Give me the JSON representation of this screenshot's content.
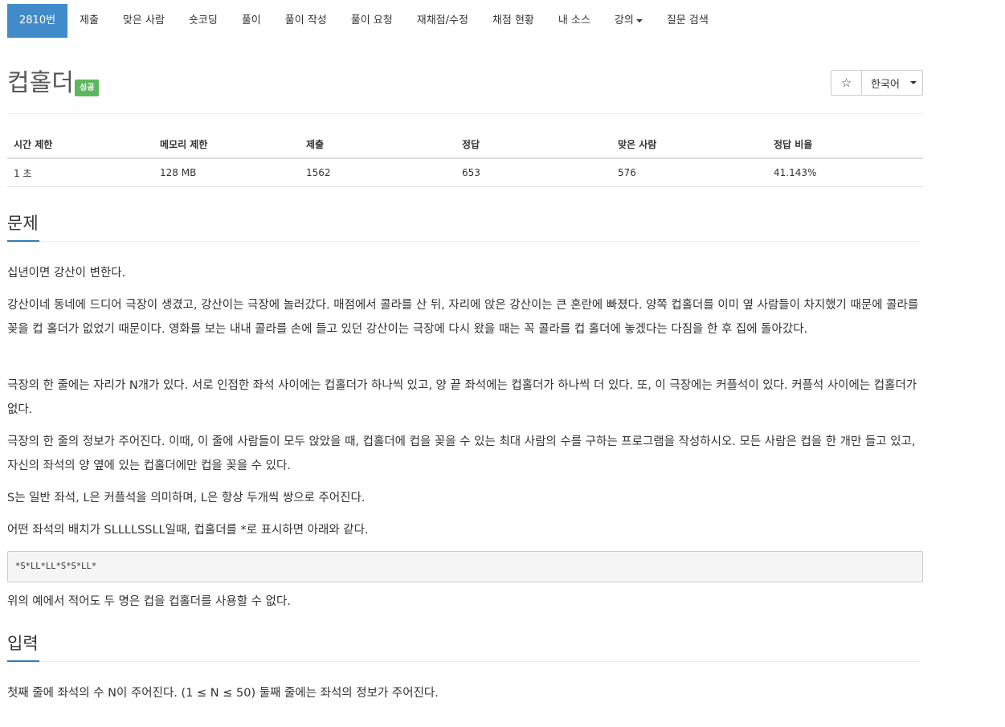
{
  "nav": {
    "items": [
      {
        "label": "2810번",
        "active": true
      },
      {
        "label": "제출"
      },
      {
        "label": "맞은 사람"
      },
      {
        "label": "숏코딩"
      },
      {
        "label": "풀이"
      },
      {
        "label": "풀이 작성"
      },
      {
        "label": "풀이 요청"
      },
      {
        "label": "재채점/수정"
      },
      {
        "label": "채점 현황"
      },
      {
        "label": "내 소스"
      },
      {
        "label": "강의",
        "dropdown": true
      },
      {
        "label": "질문 검색"
      }
    ]
  },
  "problem": {
    "title": "컵홀더",
    "status_badge": "성공",
    "status_color": "#5cb85c",
    "star_icon": "☆",
    "language": "한국어"
  },
  "info_table": {
    "headers": [
      "시간 제한",
      "메모리 제한",
      "제출",
      "정답",
      "맞은 사람",
      "정답 비율"
    ],
    "row": [
      "1 초",
      "128 MB",
      "1562",
      "653",
      "576",
      "41.143%"
    ]
  },
  "sections": {
    "problem": {
      "title": "문제",
      "paragraphs": [
        "십년이면 강산이 변한다.",
        "강산이네 동네에 드디어 극장이 생겼고, 강산이는 극장에 놀러갔다. 매점에서 콜라를 산 뒤, 자리에 앉은 강산이는 큰 혼란에 빠졌다. 양쪽 컵홀더를 이미 옆 사람들이 차지했기 때문에 콜라를 꽂을 컵 홀더가 없었기 때문이다. 영화를 보는 내내 콜라를 손에 들고 있던 강산이는 극장에 다시 왔을 때는 꼭 콜라를 컵 홀더에 놓겠다는 다짐을 한 후 집에 돌아갔다.",
        "극장의 한 줄에는 자리가 N개가 있다. 서로 인접한 좌석 사이에는 컵홀더가 하나씩 있고, 양 끝 좌석에는 컵홀더가 하나씩 더 있다. 또, 이 극장에는 커플석이 있다. 커플석 사이에는 컵홀더가 없다.",
        "극장의 한 줄의 정보가 주어진다. 이때, 이 줄에 사람들이 모두 앉았을 때, 컵홀더에 컵을 꽂을 수 있는 최대 사람의 수를 구하는 프로그램을 작성하시오. 모든 사람은 컵을 한 개만 들고 있고, 자신의 좌석의 양 옆에 있는 컵홀더에만 컵을 꽂을 수 있다.",
        "S는 일반 좌석, L은 커플석을 의미하며, L은 항상 두개씩 쌍으로 주어진다.",
        "어떤 좌석의 배치가 SLLLLSSLL일때, 컵홀더를 *로 표시하면 아래와 같다."
      ],
      "code": "*S*LL*LL*S*S*LL*",
      "after_code": "위의 예에서 적어도 두 명은 컵을 컵홀더를 사용할 수 없다."
    },
    "input": {
      "title": "입력",
      "text": "첫째 줄에 좌석의 수 N이 주어진다. (1 ≤ N ≤ 50) 둘째 줄에는 좌석의 정보가 주어진다."
    }
  },
  "colors": {
    "nav_active": "#428bca",
    "section_accent": "#337ab7"
  }
}
